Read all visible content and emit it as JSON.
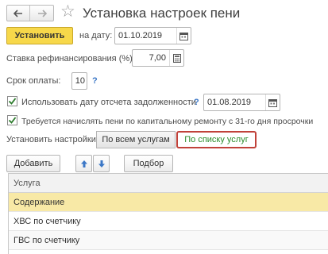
{
  "header": {
    "title": "Установка настроек пени",
    "back_icon": "arrow-left-icon",
    "forward_icon": "arrow-right-icon",
    "favorite_icon": "star-icon"
  },
  "toolbar": {
    "set_button": "Установить",
    "date_label": "на дату:",
    "date_value": "01.10.2019"
  },
  "form": {
    "refinancing_rate_label": "Ставка рефинансирования (%):",
    "refinancing_rate_value": "7,00",
    "payment_term_label": "Срок оплаты:",
    "payment_term_value": "10",
    "payment_term_help": "?",
    "use_debt_date_label": "Использовать дату отсчета задолженности",
    "use_debt_date_checked": true,
    "use_debt_date_help": "?",
    "debt_date_value": "01.08.2019",
    "capital_repair_label": "Требуется начислять пени по капитальному ремонту с 31-го дня просрочки",
    "capital_repair_checked": true
  },
  "settings": {
    "label": "Установить настройки:",
    "all_services": "По всем услугам",
    "by_service_list": "По списку услуг",
    "selected": "by_service_list"
  },
  "list_toolbar": {
    "add_button": "Добавить",
    "select_button": "Подбор",
    "move_up_icon": "arrow-up-icon",
    "move_down_icon": "arrow-down-icon"
  },
  "table": {
    "column": "Услуга",
    "rows": [
      "Содержание",
      "ХВС по счетчику",
      "ГВС по счетчику"
    ],
    "selected_index": 0
  },
  "colors": {
    "accent_yellow": "#f7d84a",
    "selected_row": "#f8e9a6",
    "highlight_border": "#c0423a",
    "link_green": "#2a8c2a",
    "help_blue": "#3b77c6"
  }
}
